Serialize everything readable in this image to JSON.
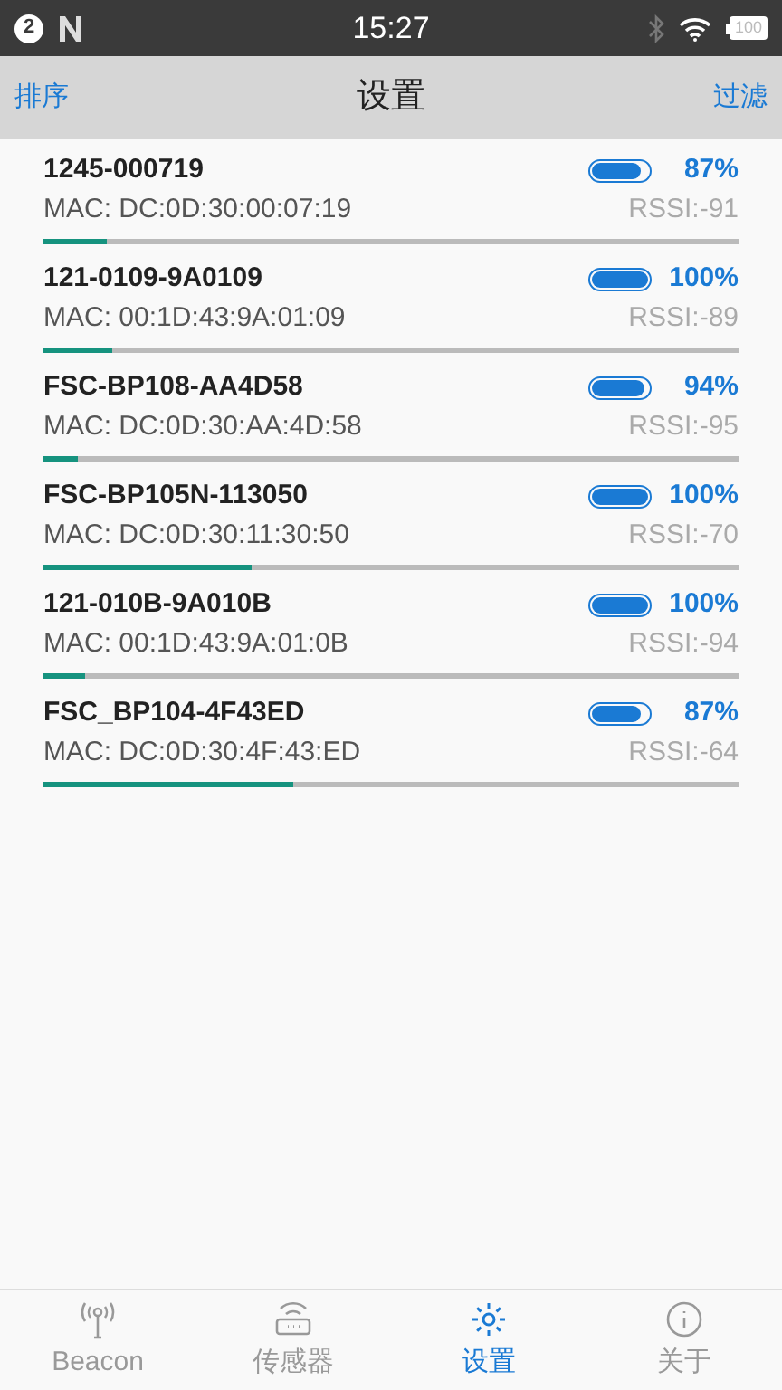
{
  "status_bar": {
    "notification_count": "2",
    "time": "15:27",
    "battery": "100"
  },
  "nav_bar": {
    "left": "排序",
    "title": "设置",
    "right": "过滤"
  },
  "devices": [
    {
      "name": "1245-000719",
      "mac": "MAC: DC:0D:30:00:07:19",
      "battery_gauge": {
        "level": 0.87
      },
      "battery": "87%",
      "rssi": "RSSI:-91",
      "signal": {
        "level": 0.09
      }
    },
    {
      "name": "121-0109-9A0109",
      "mac": "MAC: 00:1D:43:9A:01:09",
      "battery_gauge": {
        "level": 1
      },
      "battery": "100%",
      "rssi": "RSSI:-89",
      "signal": {
        "level": 0.1
      }
    },
    {
      "name": "FSC-BP108-AA4D58",
      "mac": "MAC: DC:0D:30:AA:4D:58",
      "battery_gauge": {
        "level": 0.94
      },
      "battery": "94%",
      "rssi": "RSSI:-95",
      "signal": {
        "level": 0.05
      }
    },
    {
      "name": "FSC-BP105N-113050",
      "mac": "MAC: DC:0D:30:11:30:50",
      "battery_gauge": {
        "level": 1
      },
      "battery": "100%",
      "rssi": "RSSI:-70",
      "signal": {
        "level": 0.3
      }
    },
    {
      "name": "121-010B-9A010B",
      "mac": "MAC: 00:1D:43:9A:01:0B",
      "battery_gauge": {
        "level": 1
      },
      "battery": "100%",
      "rssi": "RSSI:-94",
      "signal": {
        "level": 0.06
      }
    },
    {
      "name": "FSC_BP104-4F43ED",
      "mac": "MAC: DC:0D:30:4F:43:ED",
      "battery_gauge": {
        "level": 0.87
      },
      "battery": "87%",
      "rssi": "RSSI:-64",
      "signal": {
        "level": 0.36
      }
    }
  ],
  "tabs": [
    {
      "label": "Beacon",
      "kind": "antenna",
      "selected": false
    },
    {
      "label": "传感器",
      "kind": "router",
      "selected": false
    },
    {
      "label": "设置",
      "kind": "gear",
      "selected": true
    },
    {
      "label": "关于",
      "kind": "info",
      "selected": false
    }
  ]
}
